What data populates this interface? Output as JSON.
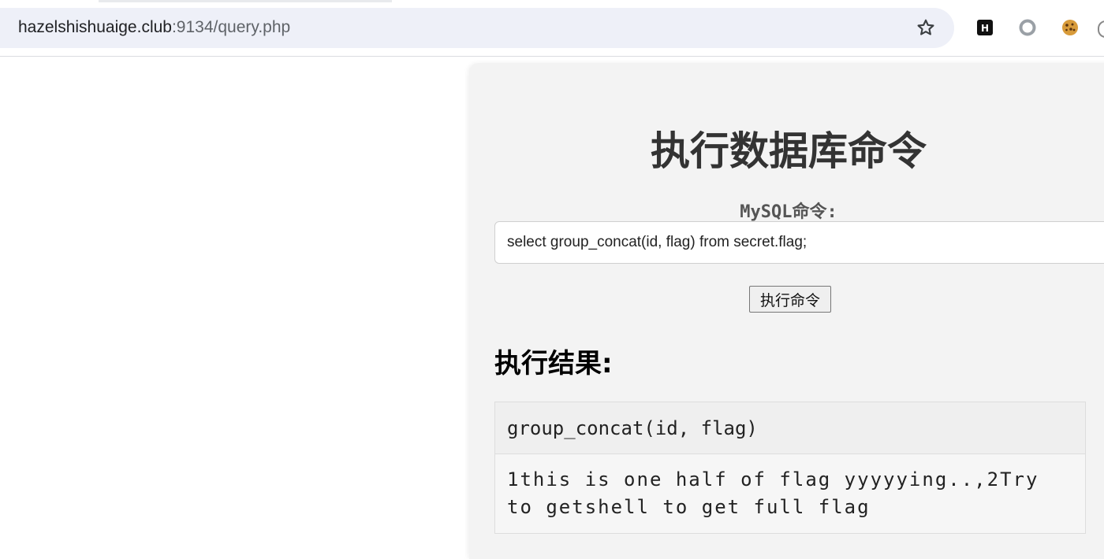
{
  "browser": {
    "url_host": "hazelshishuaige.club",
    "url_rest": ":9134/query.php",
    "icons": [
      "star-icon",
      "h-extension-icon",
      "ring-extension-icon",
      "cookie-extension-icon"
    ]
  },
  "page": {
    "title": "执行数据库命令",
    "input_label": "MySQL命令:",
    "query_value": "select group_concat(id, flag) from secret.flag;",
    "execute_button": "执行命令",
    "result_heading": "执行结果:",
    "table": {
      "columns": [
        "group_concat(id, flag)"
      ],
      "rows": [
        [
          "1this is one half of flag yyyyying..,2Try to getshell to get full flag"
        ]
      ]
    }
  },
  "colors": {
    "panel_bg": "#f3f3f3",
    "omnibox_bg": "#eef0f8"
  }
}
